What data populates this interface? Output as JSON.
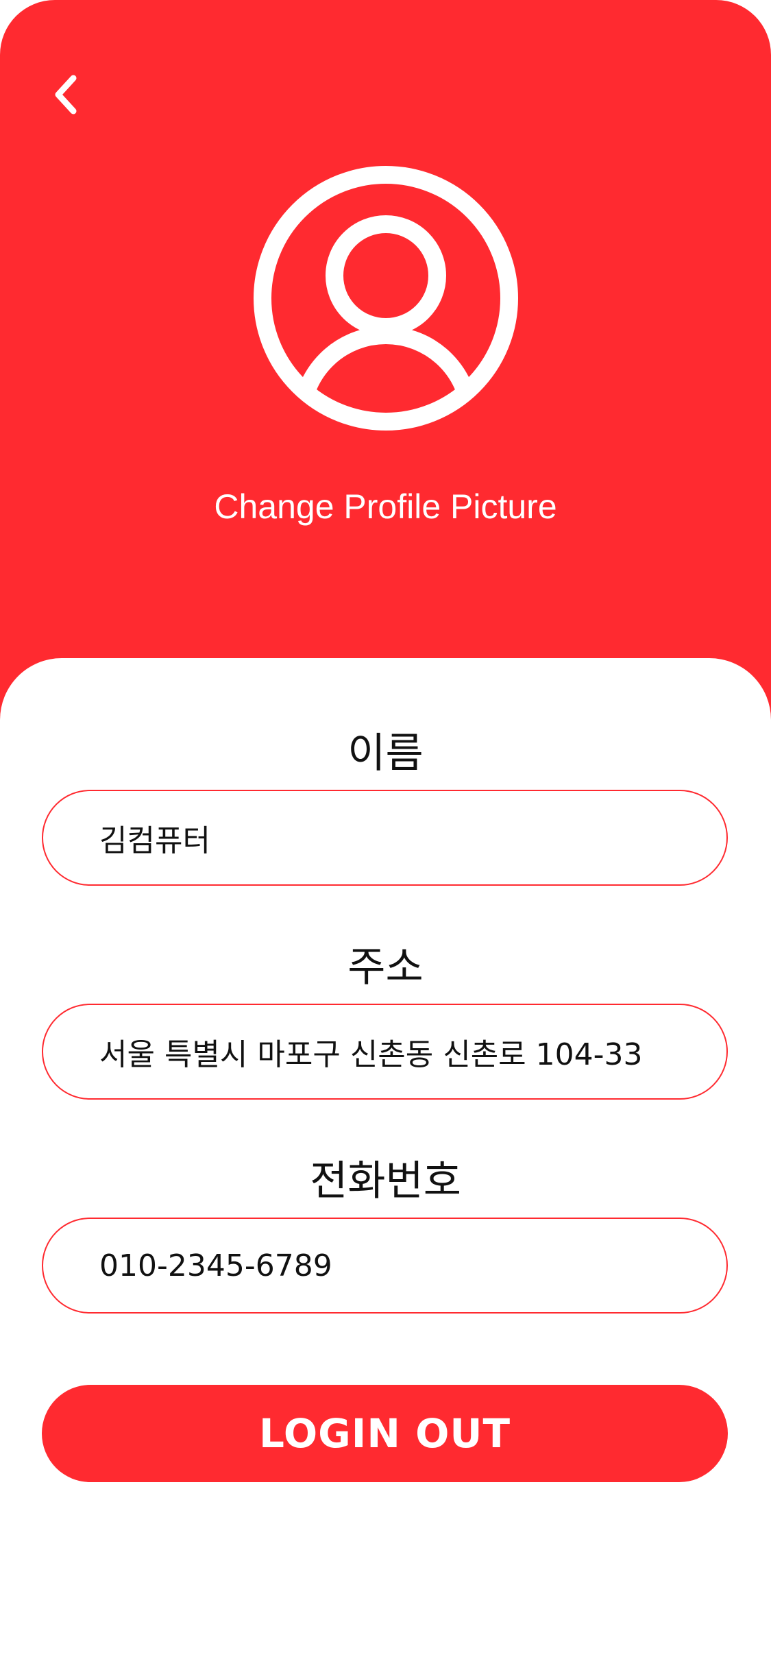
{
  "colors": {
    "accent": "#FF2A30",
    "background": "#FFFFFF",
    "text": "#111111"
  },
  "header": {
    "back_icon": "chevron-left-icon",
    "avatar_icon": "user-circle-icon",
    "change_photo_label": "Change Profile Picture"
  },
  "form": {
    "name": {
      "label": "이름",
      "value": "김컴퓨터"
    },
    "address": {
      "label": "주소",
      "value": "서울 특별시 마포구 신촌동 신촌로 104-33"
    },
    "phone": {
      "label": "전화번호",
      "value": "010-2345-6789"
    }
  },
  "logout_button": {
    "label": "LOGIN OUT"
  }
}
